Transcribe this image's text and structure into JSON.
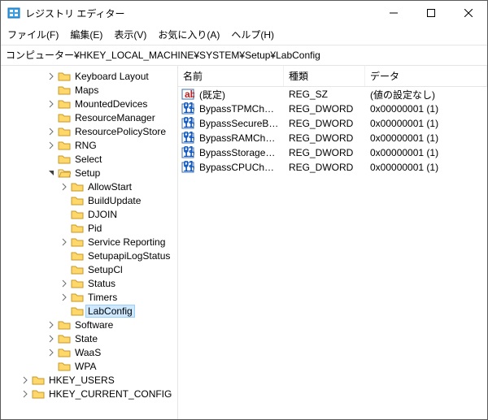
{
  "window": {
    "title": "レジストリ エディター"
  },
  "menu": {
    "file": "ファイル(F)",
    "edit": "編集(E)",
    "view": "表示(V)",
    "favorites": "お気に入り(A)",
    "help": "ヘルプ(H)"
  },
  "address": "コンピューター¥HKEY_LOCAL_MACHINE¥SYSTEM¥Setup¥LabConfig",
  "tree": [
    {
      "depth": 4,
      "expander": "closed",
      "label": "Keyboard Layout",
      "open": false
    },
    {
      "depth": 4,
      "expander": "none",
      "label": "Maps",
      "open": false
    },
    {
      "depth": 4,
      "expander": "closed",
      "label": "MountedDevices",
      "open": false
    },
    {
      "depth": 4,
      "expander": "none",
      "label": "ResourceManager",
      "open": false
    },
    {
      "depth": 4,
      "expander": "closed",
      "label": "ResourcePolicyStore",
      "open": false
    },
    {
      "depth": 4,
      "expander": "closed",
      "label": "RNG",
      "open": false
    },
    {
      "depth": 4,
      "expander": "none",
      "label": "Select",
      "open": false
    },
    {
      "depth": 4,
      "expander": "open",
      "label": "Setup",
      "open": true
    },
    {
      "depth": 5,
      "expander": "closed",
      "label": "AllowStart",
      "open": false
    },
    {
      "depth": 5,
      "expander": "none",
      "label": "BuildUpdate",
      "open": false
    },
    {
      "depth": 5,
      "expander": "none",
      "label": "DJOIN",
      "open": false
    },
    {
      "depth": 5,
      "expander": "none",
      "label": "Pid",
      "open": false
    },
    {
      "depth": 5,
      "expander": "closed",
      "label": "Service Reporting",
      "open": false
    },
    {
      "depth": 5,
      "expander": "none",
      "label": "SetupapiLogStatus",
      "open": false
    },
    {
      "depth": 5,
      "expander": "none",
      "label": "SetupCl",
      "open": false
    },
    {
      "depth": 5,
      "expander": "closed",
      "label": "Status",
      "open": false
    },
    {
      "depth": 5,
      "expander": "closed",
      "label": "Timers",
      "open": false
    },
    {
      "depth": 5,
      "expander": "none",
      "label": "LabConfig",
      "open": false,
      "selected": true
    },
    {
      "depth": 4,
      "expander": "closed",
      "label": "Software",
      "open": false
    },
    {
      "depth": 4,
      "expander": "closed",
      "label": "State",
      "open": false
    },
    {
      "depth": 4,
      "expander": "closed",
      "label": "WaaS",
      "open": false
    },
    {
      "depth": 4,
      "expander": "none",
      "label": "WPA",
      "open": false
    },
    {
      "depth": 2,
      "expander": "closed",
      "label": "HKEY_USERS",
      "open": false
    },
    {
      "depth": 2,
      "expander": "closed",
      "label": "HKEY_CURRENT_CONFIG",
      "open": false
    }
  ],
  "columns": {
    "name": "名前",
    "type": "種類",
    "data": "データ"
  },
  "values": [
    {
      "icon": "string",
      "name": "(既定)",
      "type": "REG_SZ",
      "data": "(値の設定なし)"
    },
    {
      "icon": "binary",
      "name": "BypassTPMCheck",
      "type": "REG_DWORD",
      "data": "0x00000001 (1)"
    },
    {
      "icon": "binary",
      "name": "BypassSecureBo...",
      "type": "REG_DWORD",
      "data": "0x00000001 (1)"
    },
    {
      "icon": "binary",
      "name": "BypassRAMCheck",
      "type": "REG_DWORD",
      "data": "0x00000001 (1)"
    },
    {
      "icon": "binary",
      "name": "BypassStorageC...",
      "type": "REG_DWORD",
      "data": "0x00000001 (1)"
    },
    {
      "icon": "binary",
      "name": "BypassCPUCheck",
      "type": "REG_DWORD",
      "data": "0x00000001 (1)"
    }
  ]
}
